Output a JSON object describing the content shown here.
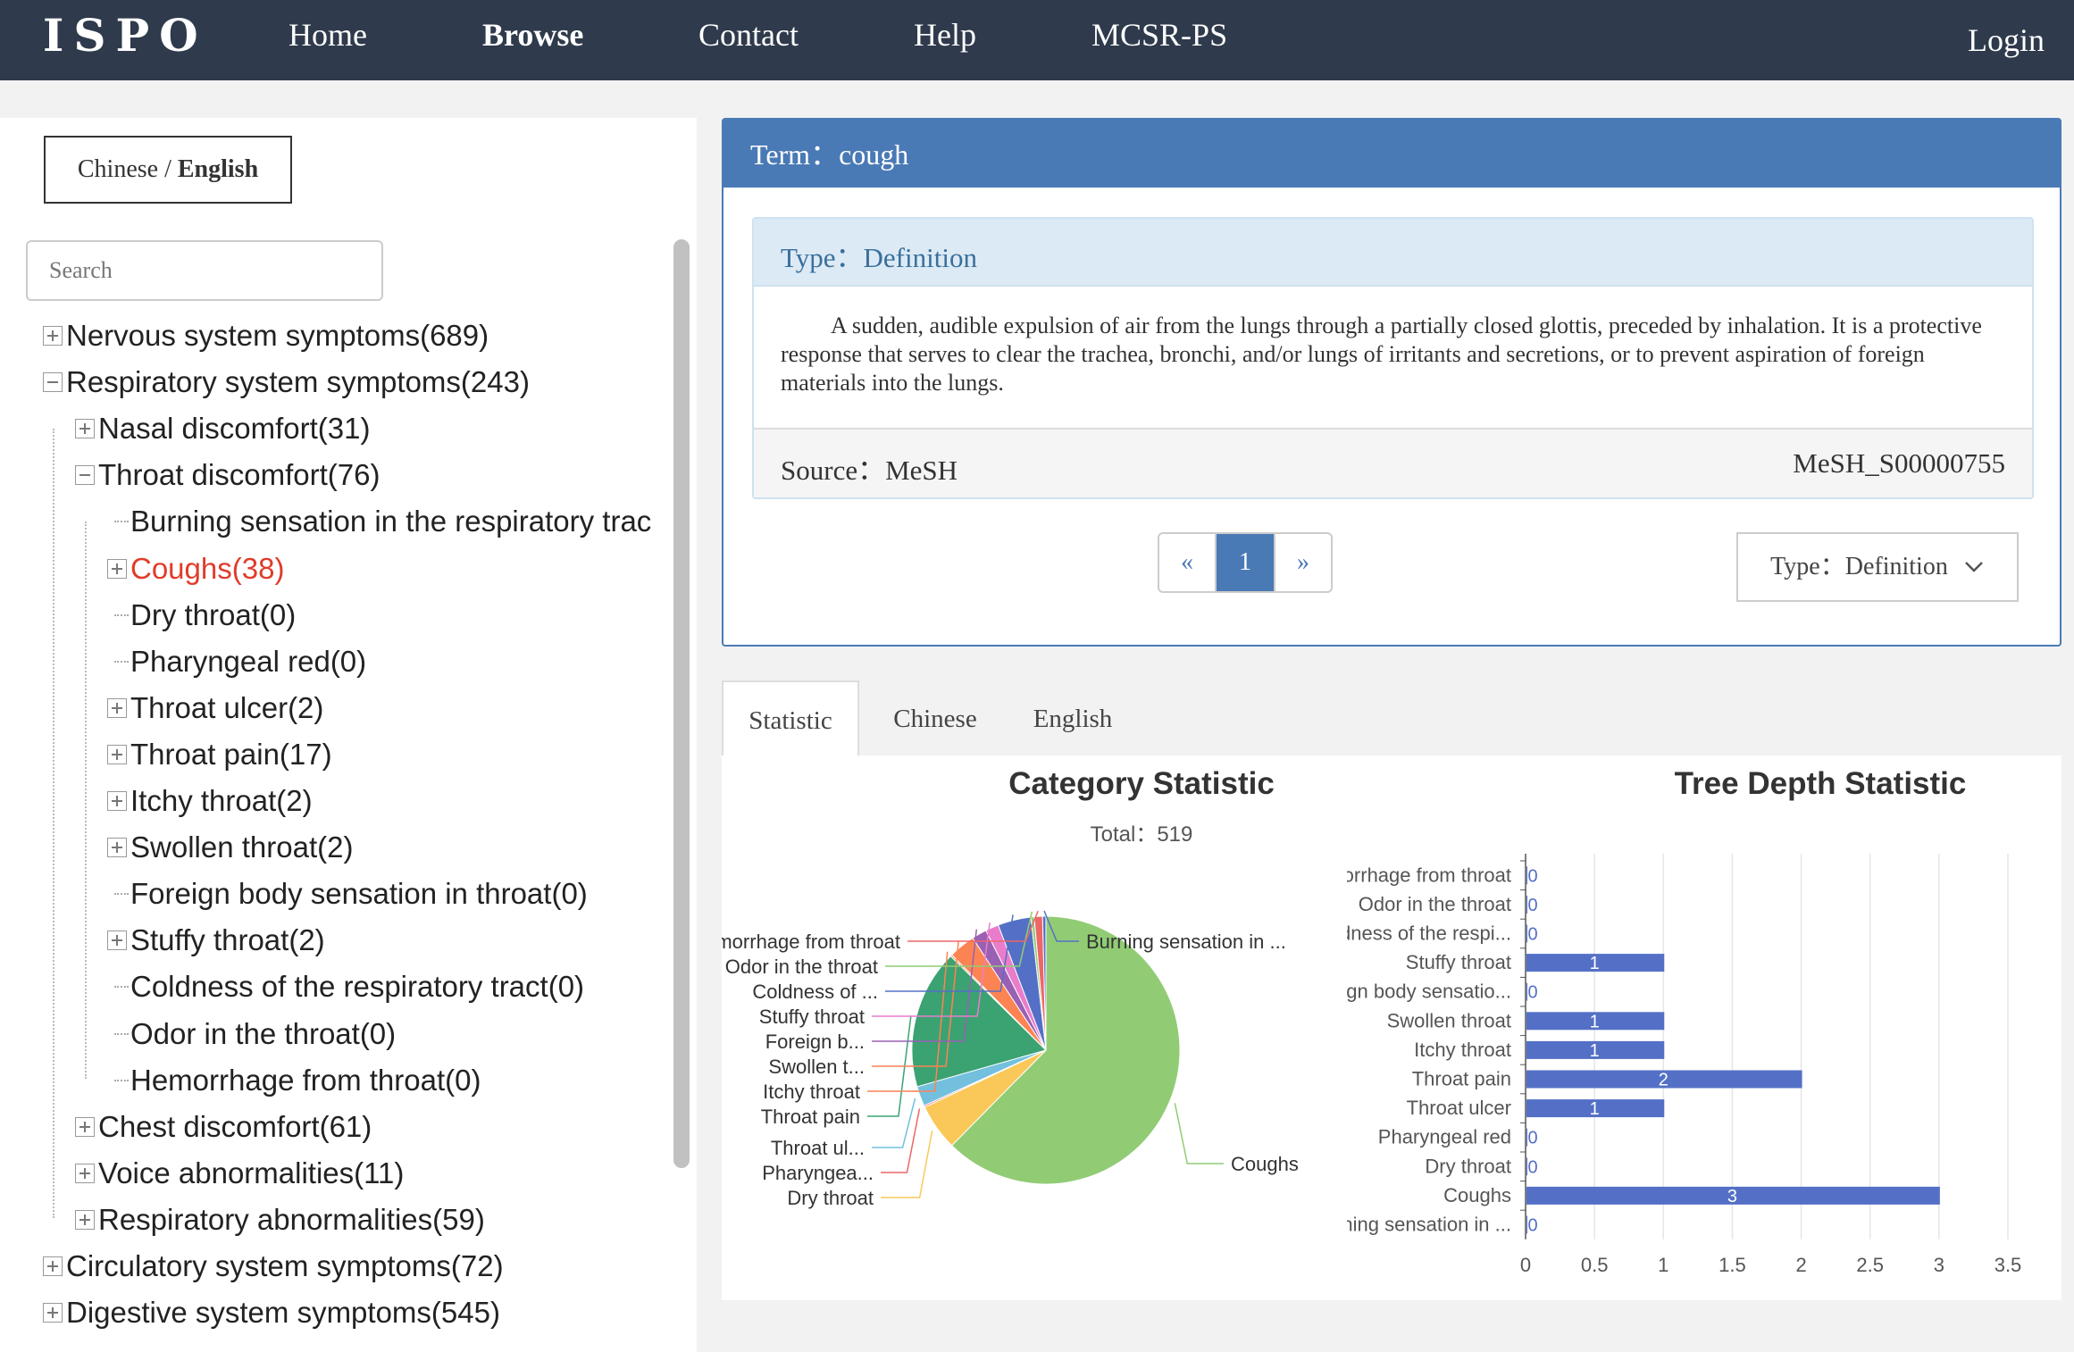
{
  "nav": {
    "logo": "ISPO",
    "items": [
      "Home",
      "Browse",
      "Contact",
      "Help",
      "MCSR-PS"
    ],
    "login": "Login"
  },
  "lang": {
    "cn": "Chinese",
    "sep": " / ",
    "en": "English"
  },
  "search": {
    "placeholder": "Search"
  },
  "tree": [
    {
      "label": "Nervous system symptoms(689)",
      "state": "plus"
    },
    {
      "label": "Respiratory system symptoms(243)",
      "state": "minus"
    },
    {
      "label": "Nasal discomfort(31)",
      "state": "plus"
    },
    {
      "label": "Throat discomfort(76)",
      "state": "minus"
    },
    {
      "label": "Burning sensation in the respiratory trac",
      "state": "leaf"
    },
    {
      "label": "Coughs(38)",
      "state": "plus",
      "selected": true
    },
    {
      "label": "Dry throat(0)",
      "state": "leaf"
    },
    {
      "label": "Pharyngeal red(0)",
      "state": "leaf"
    },
    {
      "label": "Throat ulcer(2)",
      "state": "plus"
    },
    {
      "label": "Throat pain(17)",
      "state": "plus"
    },
    {
      "label": "Itchy throat(2)",
      "state": "plus"
    },
    {
      "label": "Swollen throat(2)",
      "state": "plus"
    },
    {
      "label": "Foreign body sensation in throat(0)",
      "state": "leaf"
    },
    {
      "label": "Stuffy throat(2)",
      "state": "plus"
    },
    {
      "label": "Coldness of the respiratory tract(0)",
      "state": "leaf"
    },
    {
      "label": "Odor in the throat(0)",
      "state": "leaf"
    },
    {
      "label": "Hemorrhage from throat(0)",
      "state": "leaf"
    },
    {
      "label": "Chest discomfort(61)",
      "state": "plus"
    },
    {
      "label": "Voice abnormalities(11)",
      "state": "plus"
    },
    {
      "label": "Respiratory abnormalities(59)",
      "state": "plus"
    },
    {
      "label": "Circulatory system symptoms(72)",
      "state": "plus"
    },
    {
      "label": "Digestive system symptoms(545)",
      "state": "plus"
    }
  ],
  "term": {
    "label": "Term：",
    "value": "cough"
  },
  "definition": {
    "type_label": "Type：",
    "type_value": "Definition",
    "text": "A sudden, audible expulsion of air from the lungs through a partially closed glottis, preceded by inhalation. It is a protective response that serves to clear the trachea, bronchi, and/or lungs of irritants and secretions, or to prevent aspiration of foreign materials into the lungs.",
    "source_label": "Source：",
    "source_value": "MeSH",
    "code": "MeSH_S00000755"
  },
  "pager": {
    "prev": "«",
    "page": "1",
    "next": "»"
  },
  "type_select": {
    "label": "Type：",
    "value": "Definition"
  },
  "tabs": [
    "Statistic",
    "Chinese",
    "English"
  ],
  "colors": {
    "nav": "#2f3a4c",
    "accent": "#4a7ab5",
    "selected": "#e03c2a",
    "bar": "#5470c6"
  },
  "chart_data": [
    {
      "type": "pie",
      "title": "Category Statistic",
      "subtitle_label": "Total：",
      "subtitle_value": "519",
      "slices": [
        {
          "name": "Coughs",
          "value": 312,
          "color": "#91cc75"
        },
        {
          "name": "Dry throat",
          "value": 28,
          "color": "#fac858"
        },
        {
          "name": "Pharyngea...",
          "value": 1,
          "color": "#ee6666"
        },
        {
          "name": "Throat ul...",
          "value": 12,
          "color": "#73c0de"
        },
        {
          "name": "Throat pain",
          "value": 84,
          "color": "#3ba272"
        },
        {
          "name": "Itchy throat",
          "value": 1,
          "color": "#fc8452"
        },
        {
          "name": "Swollen t...",
          "value": 16,
          "color": "#fc8452"
        },
        {
          "name": "Foreign b...",
          "value": 9,
          "color": "#9a60b4"
        },
        {
          "name": "Stuffy throat",
          "value": 8,
          "color": "#ea7ccc"
        },
        {
          "name": "Coldness of ...",
          "value": 20,
          "color": "#5470c6"
        },
        {
          "name": "Odor in the throat",
          "value": 2,
          "color": "#91cc75"
        },
        {
          "name": "Hemorrhage from throat",
          "value": 5,
          "color": "#ee6666"
        },
        {
          "name": "Burning sensation in ...",
          "value": 2,
          "color": "#5470c6"
        }
      ]
    },
    {
      "type": "bar",
      "orientation": "horizontal",
      "title": "Tree Depth Statistic",
      "categories": [
        "Hemorrhage from throat",
        "Odor in the throat",
        "Coldness of the respi...",
        "Stuffy throat",
        "Foreign body sensatio...",
        "Swollen throat",
        "Itchy throat",
        "Throat pain",
        "Throat ulcer",
        "Pharyngeal red",
        "Dry throat",
        "Coughs",
        "Burning sensation in ..."
      ],
      "values": [
        0,
        0,
        0,
        1,
        0,
        1,
        1,
        2,
        1,
        0,
        0,
        3,
        0
      ],
      "xticks": [
        "0",
        "0.5",
        "1",
        "1.5",
        "2",
        "2.5",
        "3",
        "3.5"
      ],
      "xlim": [
        0,
        3.5
      ],
      "grid": true
    }
  ]
}
